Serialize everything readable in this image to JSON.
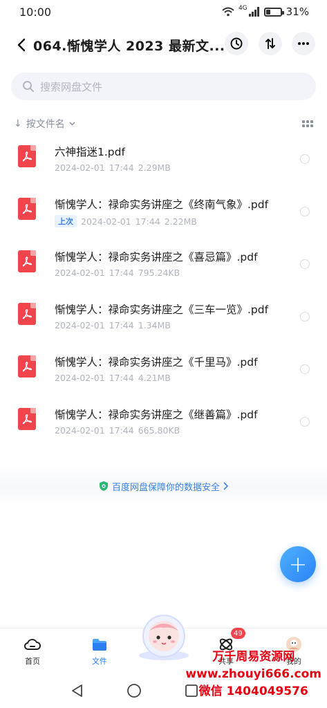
{
  "status_bar": {
    "time": "10:00",
    "network": "4G",
    "battery_percent": "31%",
    "battery_level": 0.31
  },
  "header": {
    "title": "064.惭愧学人 2023 最新文...",
    "back_icon": "chevron-left-icon",
    "actions": [
      "history-icon",
      "transfer-icon",
      "more-icon"
    ]
  },
  "search": {
    "placeholder": "搜索网盘文件",
    "icon": "search-icon"
  },
  "sort": {
    "label": "按文件名",
    "arrow": "↓",
    "view_icon": "grid-view-icon"
  },
  "files": [
    {
      "name": "六神指迷1.pdf",
      "date": "2024-02-01",
      "time": "17:44",
      "size": "2.29MB",
      "badge": ""
    },
    {
      "name": "惭愧学人：禄命实务讲座之《终南气象》.pdf",
      "date": "2024-02-01",
      "time": "17:44",
      "size": "2.22MB",
      "badge": "上次"
    },
    {
      "name": "惭愧学人：禄命实务讲座之《喜忌篇》.pdf",
      "date": "2024-02-01",
      "time": "17:44",
      "size": "795.24KB",
      "badge": ""
    },
    {
      "name": "惭愧学人：禄命实务讲座之《三车一览》.pdf",
      "date": "2024-02-01",
      "time": "17:44",
      "size": "1.34MB",
      "badge": ""
    },
    {
      "name": "惭愧学人：禄命实务讲座之《千里马》.pdf",
      "date": "2024-02-01",
      "time": "17:44",
      "size": "4.21MB",
      "badge": ""
    },
    {
      "name": "惭愧学人：禄命实务讲座之《继善篇》.pdf",
      "date": "2024-02-01",
      "time": "17:44",
      "size": "665.80KB",
      "badge": ""
    }
  ],
  "security_notice": "百度网盘保障你的数据安全",
  "fab": {
    "icon": "plus-icon",
    "label": "+"
  },
  "tabs": [
    {
      "label": "首页",
      "icon": "home-cloud-icon",
      "active": false
    },
    {
      "label": "文件",
      "icon": "folder-icon",
      "active": true
    },
    {
      "label": "共享",
      "icon": "share-orbit-icon",
      "active": false,
      "badge": "49"
    },
    {
      "label": "我的",
      "icon": "avatar-icon",
      "active": false
    }
  ],
  "watermark": {
    "line1": "万千周易资源网",
    "line2": "www.zhouyi666.com",
    "line3": "微信 1404049576"
  },
  "colors": {
    "accent": "#2d7ef0",
    "pdf": "#f0454d",
    "watermark": "#e60012"
  }
}
